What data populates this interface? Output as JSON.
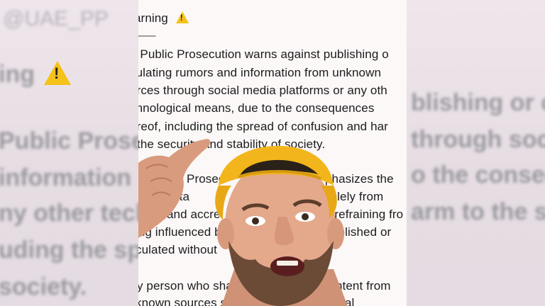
{
  "background_left": {
    "handle": "@UAE_PP",
    "lines": [
      "ing",
      "Public Prose",
      "information",
      "ny other tech",
      "uding the sp",
      "society."
    ]
  },
  "background_right": {
    "lines": [
      "blishing or ci",
      "through soci",
      "o the conseq",
      "arm to the s"
    ]
  },
  "tweet": {
    "title": "arning",
    "separator": "—–",
    "lines": [
      "e Public Prosecution warns against publishing o",
      "culating rumors and information from unknown",
      "urces through social media platforms or any oth",
      "chnological means, due to the consequences",
      "ereof, including the spread of confusion and har",
      "the security and stability of society.",
      "Prosec",
      "phasizes the",
      "y of obta",
      "solely from",
      "and accre",
      "d refraining fro",
      "ing influenced b",
      "ublished or",
      "culated without",
      "y person who sha",
      "ntent from",
      "known sources shal",
      "legal"
    ]
  },
  "colors": {
    "warning": "#f5c21a",
    "cap": "#f2b51c",
    "skin": "#e4a88b",
    "beard": "#6b4a36"
  },
  "icons": [
    "warning-icon"
  ]
}
